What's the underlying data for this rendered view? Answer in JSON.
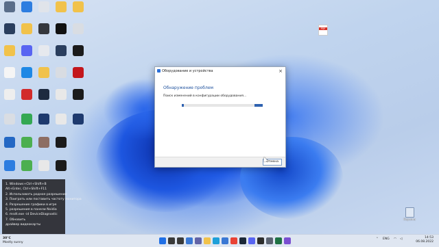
{
  "desktop": {
    "icons": [
      {
        "label": "",
        "color": "#5a6d8a"
      },
      {
        "label": "",
        "color": "#2d7de0"
      },
      {
        "label": "",
        "color": "#e0e4ea"
      },
      {
        "label": "",
        "color": "#f1c24b"
      },
      {
        "label": "",
        "color": "#f1c24b"
      },
      {
        "label": "",
        "color": "#2a3e5e"
      },
      {
        "label": "",
        "color": "#f1c24b"
      },
      {
        "label": "",
        "color": "#34373d"
      },
      {
        "label": "",
        "color": "#111111"
      },
      {
        "label": "",
        "color": "#d9dde3"
      },
      {
        "label": "",
        "color": "#f1c24b"
      },
      {
        "label": "",
        "color": "#5865f2"
      },
      {
        "label": "",
        "color": "#e6e9ee"
      },
      {
        "label": "",
        "color": "#2a3e5e"
      },
      {
        "label": "",
        "color": "#1b1b1b"
      },
      {
        "label": "",
        "color": "#f5f5f5"
      },
      {
        "label": "",
        "color": "#1e88e5"
      },
      {
        "label": "",
        "color": "#f1c24b"
      },
      {
        "label": "",
        "color": "#d8dce2"
      },
      {
        "label": "",
        "color": "#c3161c"
      },
      {
        "label": "",
        "color": "#eeeeee"
      },
      {
        "label": "",
        "color": "#d22b2b"
      },
      {
        "label": "",
        "color": "#1d2a3f"
      },
      {
        "label": "",
        "color": "#e8e8e8"
      },
      {
        "label": "",
        "color": "#1b1b1b"
      },
      {
        "label": "",
        "color": "#d9dde3"
      },
      {
        "label": "",
        "color": "#34a853"
      },
      {
        "label": "",
        "color": "#1e3a6e"
      },
      {
        "label": "",
        "color": "#e8e8e8"
      },
      {
        "label": "",
        "color": "#1e3a6e"
      },
      {
        "label": "",
        "color": "#2468c4"
      },
      {
        "label": "",
        "color": "#4caf50"
      },
      {
        "label": "",
        "color": "#8d6e63"
      },
      {
        "label": "",
        "color": "#1b1b1b"
      },
      {
        "label": "",
        "color": "#2d7de0"
      },
      {
        "label": "",
        "color": "#4caf50"
      },
      {
        "label": "",
        "color": "#e8e8e8"
      },
      {
        "label": "",
        "color": "#1b1b1b"
      }
    ],
    "pdf_file": {
      "badge": "PDF",
      "label": ""
    },
    "recycle_bin": {
      "label": "Корзина"
    }
  },
  "dialog": {
    "title": "Оборудование и устройства",
    "heading": "Обнаружение проблем",
    "status": "Поиск изменений в конфигурации оборудования...",
    "progress": 0.45,
    "cancel_label": "Отмена",
    "close_glyph": "×",
    "accent": "#2f62b0"
  },
  "notes": {
    "lines": [
      "1. Windows+Ctrl+Shift+B",
      "Alt+Enter, Ctrl+Shift+F11",
      "2. Использовать родное разрешение",
      "3. Поиграть или поставить частоту монитора",
      "4. Разрешение графики в игре",
      "5. разрешения в панели Nvidia",
      "6. msdt.exe -id DeviceDiagnostic",
      "7. Обновить",
      "драйвер видеокарты"
    ]
  },
  "taskbar": {
    "weather_temp": "30°C",
    "weather_desc": "Mostly sunny",
    "lang": "ENG",
    "time": "14:53",
    "date": "06.08.2022",
    "apps": [
      {
        "name": "start-icon",
        "color": "#1f6fe5"
      },
      {
        "name": "search-icon",
        "color": "#3a3a3a"
      },
      {
        "name": "task-view-icon",
        "color": "#3a3a3a"
      },
      {
        "name": "widgets-icon",
        "color": "#3a78d4"
      },
      {
        "name": "chat-icon",
        "color": "#6264a7"
      },
      {
        "name": "explorer-icon",
        "color": "#f1c24b"
      },
      {
        "name": "edge-icon",
        "color": "#1fa0d9"
      },
      {
        "name": "store-icon",
        "color": "#3a78d4"
      },
      {
        "name": "chrome-icon",
        "color": "#e94235"
      },
      {
        "name": "steam-icon",
        "color": "#1b2838"
      },
      {
        "name": "discord-icon",
        "color": "#5865f2"
      },
      {
        "name": "obs-icon",
        "color": "#2d2d2d"
      },
      {
        "name": "settings-icon",
        "color": "#5a6270"
      },
      {
        "name": "excel-icon",
        "color": "#1f7244"
      },
      {
        "name": "app-icon",
        "color": "#7a4fd1"
      }
    ]
  }
}
